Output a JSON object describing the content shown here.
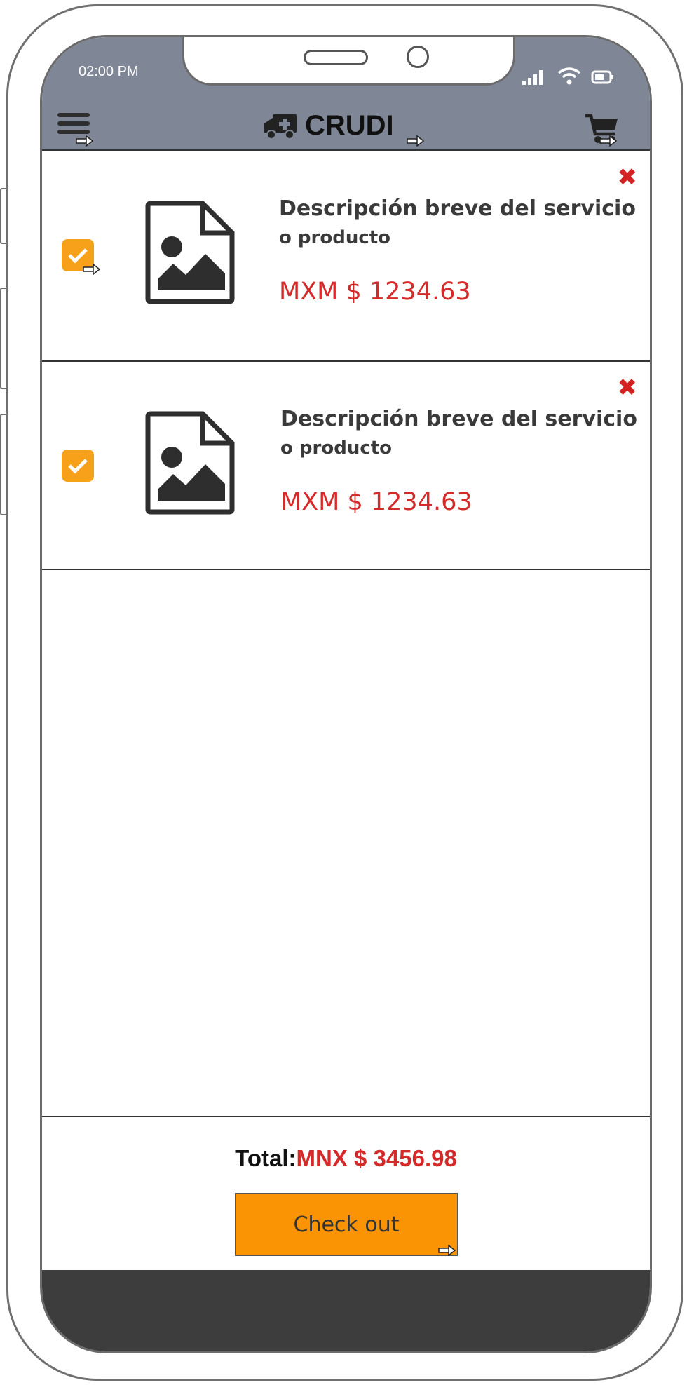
{
  "status_bar": {
    "time": "02:00 PM"
  },
  "header": {
    "app_title": "CRUDI"
  },
  "cart": {
    "items": [
      {
        "description_line1": "Descripción breve del servicio",
        "description_line2": "o producto",
        "price": "MXM $ 1234.63",
        "checked": true
      },
      {
        "description_line1": "Descripción breve del servicio",
        "description_line2": "o producto",
        "price": "MXM $ 1234.63",
        "checked": true
      }
    ],
    "total_label": "Total:",
    "total_value": "MNX $ 3456.98",
    "checkout_label": "Check out"
  },
  "icons": {
    "menu": "hamburger-menu-icon",
    "brand": "ambulance-icon",
    "cart": "shopping-cart-icon",
    "remove": "close-icon",
    "thumbnail": "image-file-icon",
    "checkbox": "checkmark-icon"
  },
  "colors": {
    "header_bg": "#7f8696",
    "accent_orange": "#fa9405",
    "price_red": "#d42a2a",
    "bottom_bar": "#3d3d3d"
  }
}
